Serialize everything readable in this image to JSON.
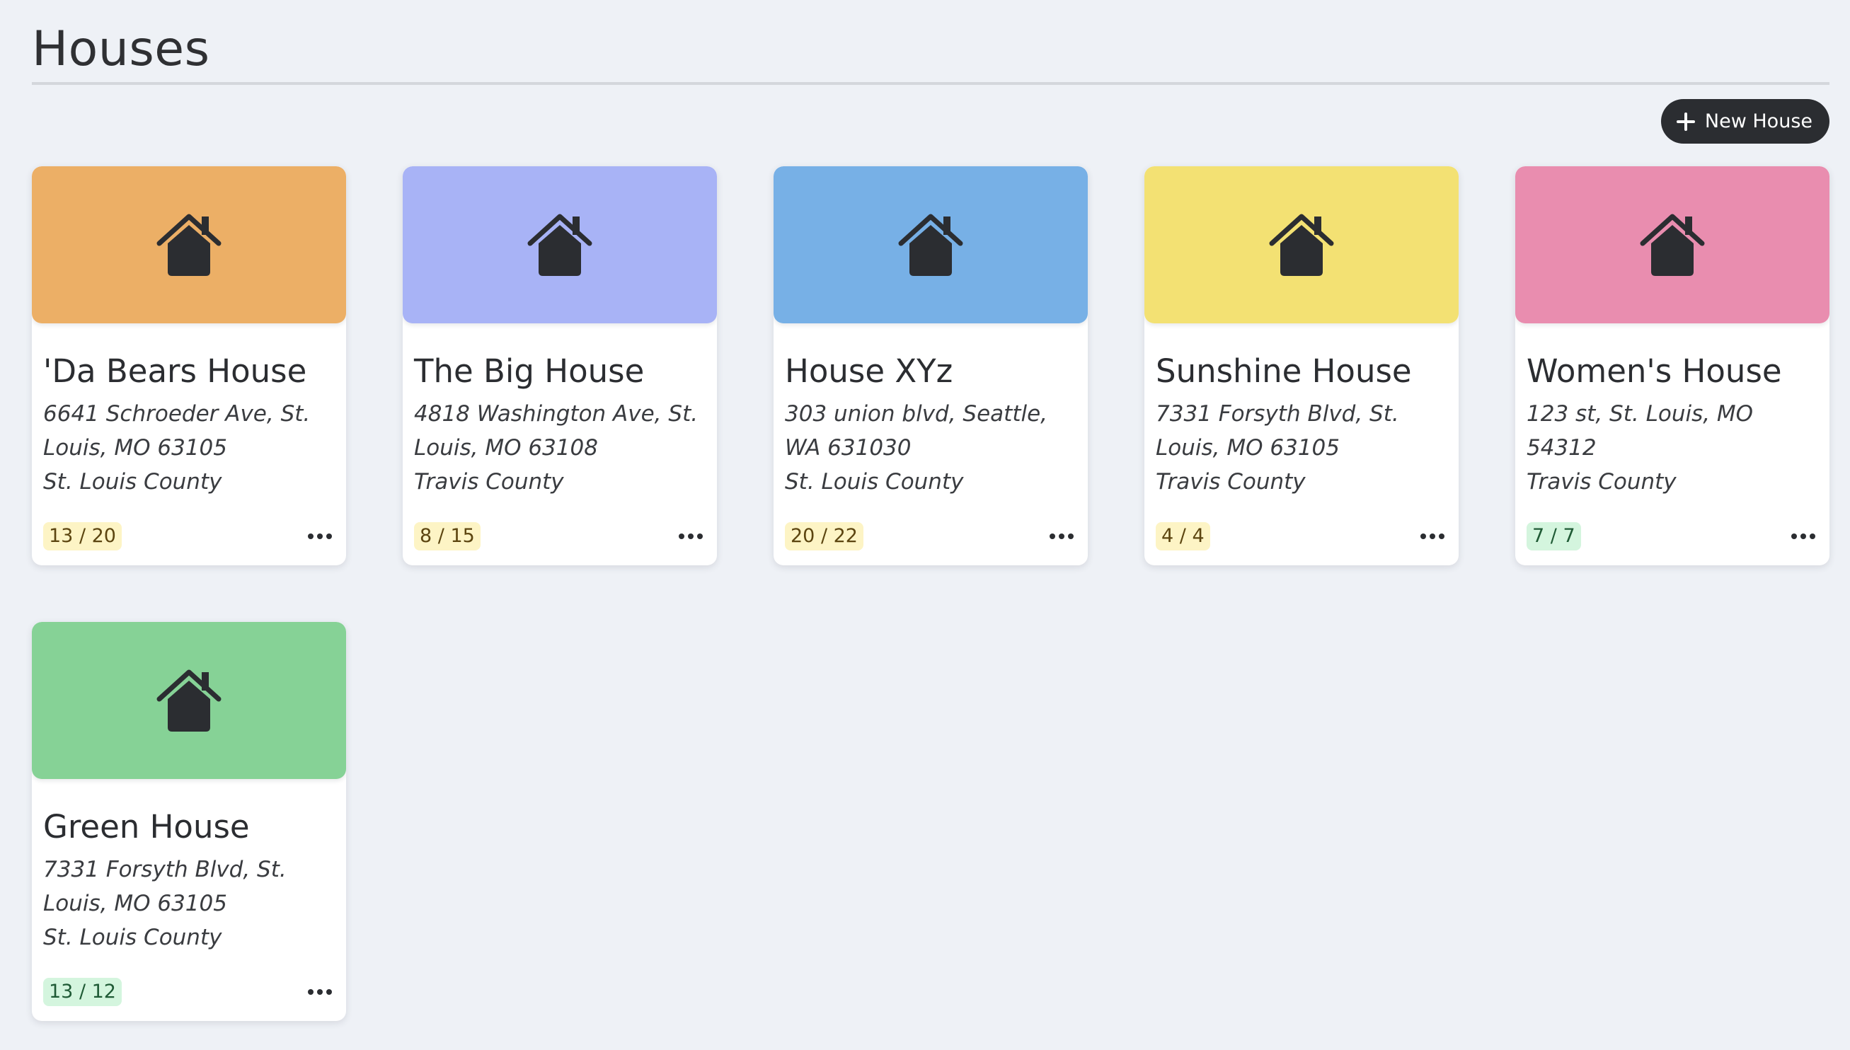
{
  "page": {
    "title": "Houses"
  },
  "toolbar": {
    "new_house_label": "New House",
    "new_house_icon": "plus-icon"
  },
  "houses": [
    {
      "name": "'Da Bears House",
      "address": "6641 Schroeder Ave, St. Louis, MO 63105",
      "county": "St. Louis County",
      "count": "13 / 20",
      "status": "warn",
      "color": "#ecaf66",
      "icon": "house-icon"
    },
    {
      "name": "The Big House",
      "address": "4818 Washington Ave, St. Louis, MO 63108",
      "county": "Travis County",
      "count": "8 / 15",
      "status": "warn",
      "color": "#a8b3f6",
      "icon": "house-icon"
    },
    {
      "name": "House XYz",
      "address": "303 union blvd, Seattle, WA 631030",
      "county": "St. Louis County",
      "count": "20 / 22",
      "status": "warn",
      "color": "#77b0e6",
      "icon": "house-icon"
    },
    {
      "name": "Sunshine House",
      "address": "7331 Forsyth Blvd, St. Louis, MO 63105",
      "county": "Travis County",
      "count": "4 / 4",
      "status": "warn",
      "color": "#f3e173",
      "icon": "house-icon"
    },
    {
      "name": "Women's House",
      "address": "123 st, St. Louis, MO 54312",
      "county": "Travis County",
      "count": "7 / 7",
      "status": "ok",
      "color": "#e98daf",
      "icon": "house-icon"
    },
    {
      "name": "Green House",
      "address": "7331 Forsyth Blvd, St. Louis, MO 63105",
      "county": "St. Louis County",
      "count": "13 / 12",
      "status": "ok",
      "color": "#86d296",
      "icon": "house-icon"
    }
  ],
  "colors": {
    "background": "#eef1f6",
    "dark": "#2b2d31",
    "badge_warn_bg": "#fdf4c5",
    "badge_ok_bg": "#d4f5de"
  }
}
